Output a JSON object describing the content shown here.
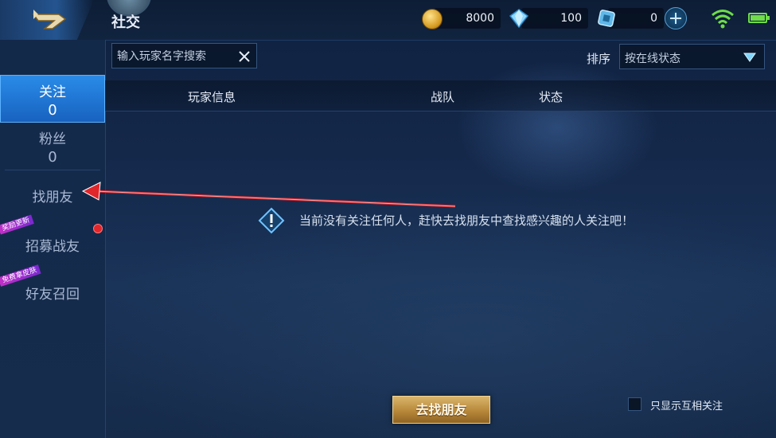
{
  "header": {
    "title": "社交",
    "back_icon": "back-arrow-icon",
    "currencies": [
      {
        "icon": "gold-coin-icon",
        "value": "8000"
      },
      {
        "icon": "diamond-icon",
        "value": "100"
      },
      {
        "icon": "voucher-icon",
        "value": "0"
      }
    ],
    "status": {
      "wifi": "wifi-icon",
      "battery": "battery-icon"
    }
  },
  "search": {
    "placeholder": "输入玩家名字搜索"
  },
  "sort": {
    "label": "排序",
    "selected": "按在线状态"
  },
  "sidebar": {
    "items": [
      {
        "label": "关注",
        "count": "0"
      },
      {
        "label": "粉丝",
        "count": "0"
      },
      {
        "label": "找朋友"
      },
      {
        "label": "招募战友",
        "ribbon": "奖励更新"
      },
      {
        "label": "好友召回",
        "ribbon": "免费拿皮肤"
      }
    ]
  },
  "table": {
    "columns": [
      "玩家信息",
      "战队",
      "状态"
    ]
  },
  "empty_message": "当前没有关注任何人，赶快去找朋友中查找感兴趣的人关注吧！",
  "footer": {
    "find_button": "去找朋友",
    "mutual_filter_label": "只显示互相关注"
  },
  "colors": {
    "accent": "#1f77d6",
    "button_gold": "#c49a4e",
    "annotation_red": "#e0262b"
  }
}
